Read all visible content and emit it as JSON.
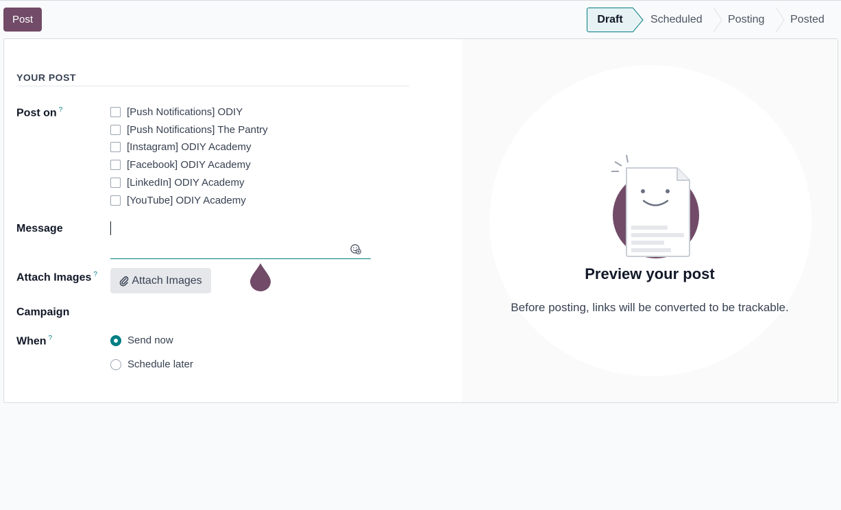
{
  "toolbar": {
    "post_label": "Post"
  },
  "status": {
    "stages": [
      "Draft",
      "Scheduled",
      "Posting",
      "Posted"
    ],
    "active": "Draft"
  },
  "form": {
    "section_title": "YOUR POST",
    "post_on_label": "Post on",
    "help_mark": "?",
    "accounts": [
      "[Push Notifications] ODIY",
      "[Push Notifications] The Pantry",
      "[Instagram] ODIY Academy",
      "[Facebook] ODIY Academy",
      "[LinkedIn] ODIY Academy",
      "[YouTube] ODIY Academy"
    ],
    "message_label": "Message",
    "message_value": "",
    "attach_label": "Attach Images",
    "attach_button": "Attach Images",
    "campaign_label": "Campaign",
    "when_label": "When",
    "when_options": [
      "Send now",
      "Schedule later"
    ],
    "when_selected": "Send now"
  },
  "preview": {
    "title": "Preview your post",
    "subtitle": "Before posting, links will be converted to be trackable."
  },
  "colors": {
    "brand": "#714b67",
    "accent": "#017e84"
  },
  "icons": [
    "paperclip-icon",
    "emoji-icon",
    "document-face-icon",
    "drop-icon"
  ]
}
